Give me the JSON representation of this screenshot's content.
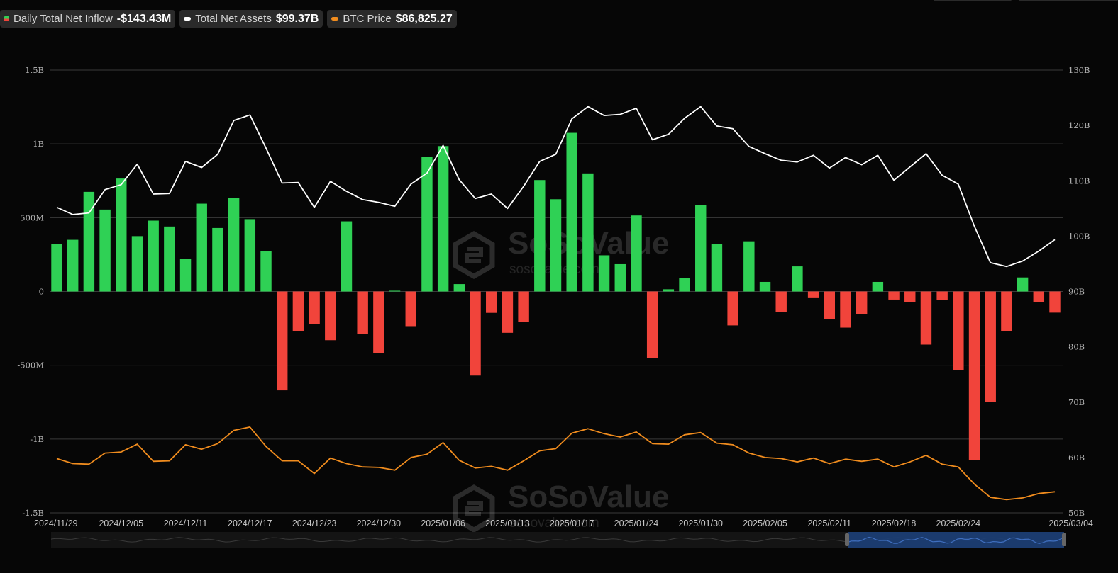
{
  "legend": {
    "inflow": {
      "label": "Daily Total Net Inflow",
      "value": "-$143.43M"
    },
    "assets": {
      "label": "Total Net Assets",
      "value": "$99.37B"
    },
    "btc": {
      "label": "BTC Price",
      "value": "$86,825.27"
    }
  },
  "watermark": {
    "brand": "SoSoValue",
    "url": "sosovalue.com"
  },
  "colors": {
    "positive": "#2fd155",
    "negative": "#f1443b",
    "assets_line": "#ffffff",
    "btc_line": "#f08c1e",
    "grid": "#3a3a3a",
    "navigator_fill": "#1c3f78"
  },
  "chart_data": {
    "type": "bar",
    "title": "",
    "left_axis": {
      "ticks": [
        "1.5B",
        "1B",
        "500M",
        "0",
        "-500M",
        "-1B",
        "-1.5B"
      ],
      "range": [
        -1500,
        1500
      ],
      "unit": "M USD"
    },
    "right_axis": {
      "ticks": [
        "130B",
        "120B",
        "110B",
        "100B",
        "90B",
        "80B",
        "70B",
        "60B",
        "50B"
      ],
      "range": [
        50,
        130
      ],
      "unit": "B USD"
    },
    "x_tick_labels": [
      "2024/11/29",
      "2024/12/05",
      "2024/12/11",
      "2024/12/17",
      "2024/12/23",
      "2024/12/30",
      "2025/01/06",
      "2025/01/13",
      "2025/01/17",
      "2025/01/24",
      "2025/01/30",
      "2025/02/05",
      "2025/02/11",
      "2025/02/18",
      "2025/02/24",
      "2025/03/04"
    ],
    "x_tick_index": [
      0,
      4,
      8,
      12,
      16,
      20,
      24,
      28,
      32,
      36,
      40,
      44,
      48,
      52,
      56,
      63
    ],
    "grid": true,
    "legend_position": "top-left",
    "series": [
      {
        "name": "Daily Total Net Inflow",
        "axis": "left",
        "kind": "bar",
        "values": [
          320,
          350,
          675,
          555,
          765,
          375,
          480,
          440,
          220,
          595,
          430,
          635,
          490,
          275,
          -670,
          -270,
          -220,
          -330,
          475,
          -290,
          -420,
          5,
          -235,
          910,
          985,
          50,
          -570,
          -145,
          -280,
          -205,
          755,
          625,
          1075,
          800,
          245,
          185,
          515,
          -450,
          15,
          90,
          585,
          320,
          -230,
          340,
          65,
          -140,
          170,
          -45,
          -185,
          -245,
          -155,
          65,
          -55,
          -70,
          -360,
          -60,
          -535,
          -1140,
          -750,
          -270,
          95,
          -70,
          -143.43
        ]
      },
      {
        "name": "Total Net Assets",
        "axis": "right",
        "kind": "line",
        "values": [
          105.2,
          103.9,
          104.2,
          108.4,
          109.3,
          113.0,
          107.6,
          107.7,
          113.5,
          112.4,
          114.8,
          120.9,
          121.9,
          115.9,
          109.6,
          109.7,
          105.2,
          109.9,
          108.1,
          106.6,
          106.1,
          105.4,
          109.4,
          111.4,
          116.4,
          110.2,
          106.8,
          107.6,
          105.0,
          109.0,
          113.5,
          114.8,
          121.2,
          123.4,
          121.8,
          122.0,
          123.1,
          117.4,
          118.4,
          121.3,
          123.4,
          119.9,
          119.4,
          116.2,
          114.9,
          113.7,
          113.4,
          114.6,
          112.3,
          114.2,
          112.9,
          114.6,
          110.1,
          112.5,
          114.9,
          111.0,
          109.4,
          101.8,
          95.2,
          94.5,
          95.5,
          97.3,
          99.37
        ]
      },
      {
        "name": "BTC Price",
        "axis": "right",
        "kind": "line",
        "values": [
          59.8,
          58.9,
          58.8,
          60.8,
          61.0,
          62.4,
          59.3,
          59.4,
          62.3,
          61.5,
          62.5,
          64.9,
          65.5,
          62.0,
          59.4,
          59.4,
          57.1,
          59.9,
          58.9,
          58.3,
          58.2,
          57.7,
          60.0,
          60.6,
          62.7,
          59.5,
          58.1,
          58.4,
          57.7,
          59.4,
          61.2,
          61.6,
          64.4,
          65.2,
          64.3,
          63.7,
          64.6,
          62.5,
          62.4,
          64.1,
          64.5,
          62.6,
          62.3,
          60.8,
          60.0,
          59.8,
          59.2,
          59.9,
          58.9,
          59.7,
          59.3,
          59.7,
          58.3,
          59.2,
          60.4,
          58.8,
          58.3,
          55.2,
          52.8,
          52.4,
          52.7,
          53.5,
          53.8
        ]
      }
    ]
  }
}
